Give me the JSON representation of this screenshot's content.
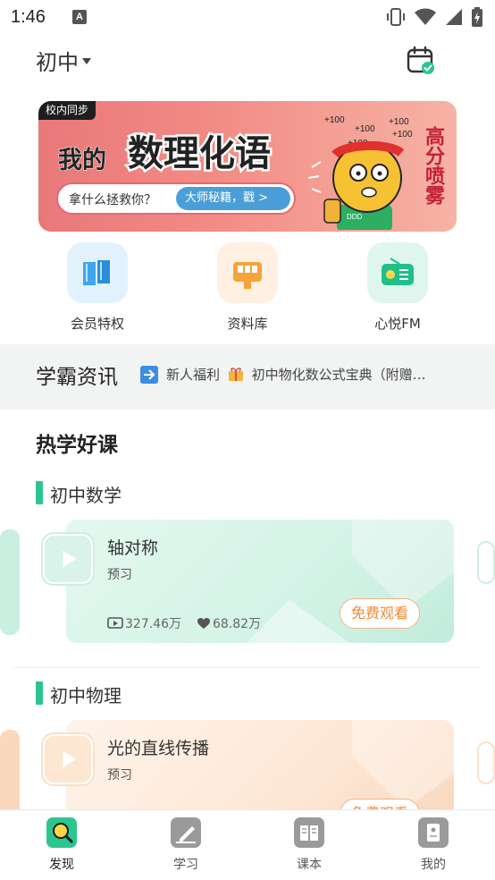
{
  "status_bar": {
    "time": "1:46",
    "notification_icon": "a-icon",
    "icons": [
      "vibrate-icon",
      "wifi-icon",
      "signal-icon",
      "battery-icon"
    ]
  },
  "header": {
    "grade": "初中",
    "calendar_icon": "calendar-check-icon"
  },
  "banner": {
    "tag": "校内同步",
    "title_prefix": "我的",
    "title_main": "数理化语",
    "question": "拿什么拯救你？",
    "cta": "大师秘籍，戳 >",
    "side_text": "高分喷雾",
    "score_marks": [
      "+100",
      "+100",
      "+100",
      "+100",
      "+100"
    ],
    "mascot_badge": "DDD"
  },
  "quick_entries": [
    {
      "label": "会员特权",
      "icon": "book-icon",
      "color": "#3ea6f0"
    },
    {
      "label": "资料库",
      "icon": "bus-icon",
      "color": "#f5a33a"
    },
    {
      "label": "心悦FM",
      "icon": "radio-icon",
      "color": "#1fbf8a"
    }
  ],
  "news": {
    "title": "学霸资讯",
    "text_a": "新人福利",
    "text_b": "初中物化数公式宝典（附赠…"
  },
  "hot_courses": {
    "title": "热学好课",
    "subjects": [
      {
        "name": "初中数学",
        "course": {
          "title": "轴对称",
          "tag": "预习",
          "views": "327.46万",
          "likes": "68.82万",
          "button": "免费观看"
        }
      },
      {
        "name": "初中物理",
        "course": {
          "title": "光的直线传播",
          "tag": "预习",
          "button": "免费观看"
        }
      }
    ]
  },
  "tabs": [
    {
      "label": "发现",
      "icon": "magnifier-icon",
      "active": true
    },
    {
      "label": "学习",
      "icon": "pencil-icon",
      "active": false
    },
    {
      "label": "课本",
      "icon": "textbook-icon",
      "active": false
    },
    {
      "label": "我的",
      "icon": "profile-icon",
      "active": false
    }
  ],
  "colors": {
    "accent": "#2dc58f",
    "cta_orange": "#f08a3a",
    "banner_red": "#e9787a"
  }
}
